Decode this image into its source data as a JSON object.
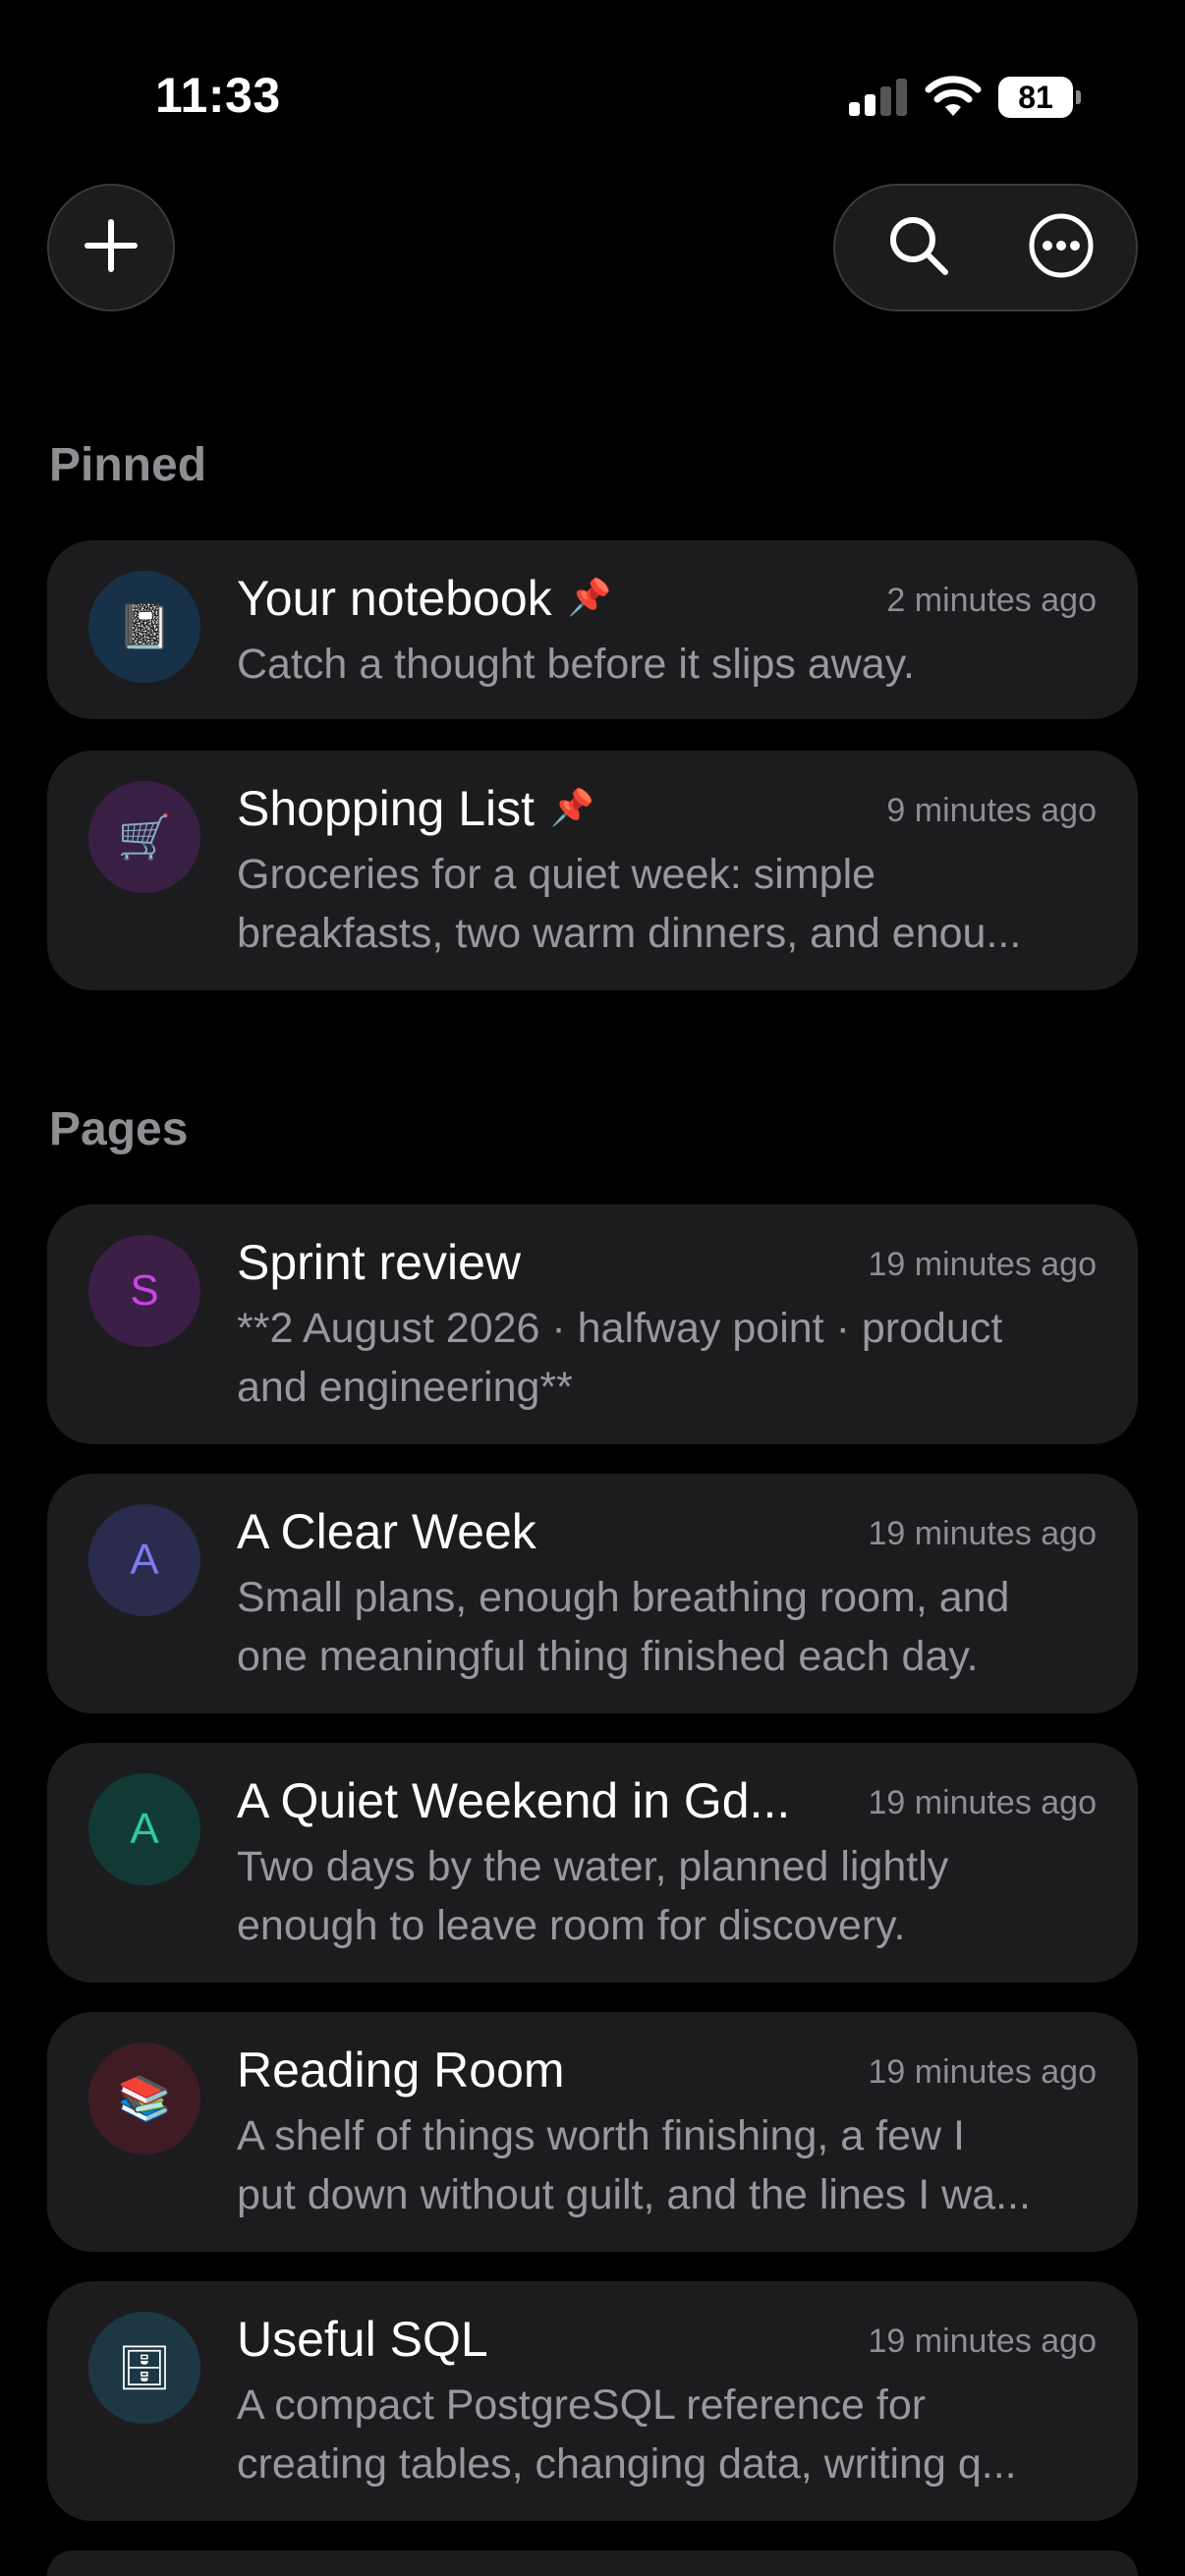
{
  "status_bar": {
    "time": "11:33",
    "battery": "81"
  },
  "sections": {
    "pinned": "Pinned",
    "pages": "Pages"
  },
  "pinned": [
    {
      "title": "Your notebook",
      "time": "2 minutes ago",
      "desc": "Catch a thought before it slips away.",
      "icon": "notebook-emoji",
      "glyph": "📓",
      "avatar_bg": "#173248"
    },
    {
      "title": "Shopping List",
      "time": "9 minutes ago",
      "desc": "Groceries for a quiet week: simple\nbreakfasts, two warm dinners, and enou...",
      "icon": "shopping-cart-emoji",
      "glyph": "🛒",
      "avatar_bg": "#3a1f45"
    }
  ],
  "pages": [
    {
      "title": "Sprint review",
      "time": "19 minutes ago",
      "desc": "**2 August 2026 · halfway point · product\nand engineering**",
      "letter": "S",
      "letter_color": "#c946e0",
      "avatar_bg": "#3b1f47"
    },
    {
      "title": "A Clear Week",
      "time": "19 minutes ago",
      "desc": "Small plans, enough breathing room, and\none meaningful thing finished each day.",
      "letter": "A",
      "letter_color": "#7b7cf2",
      "avatar_bg": "#2a2b4d"
    },
    {
      "title": "A Quiet Weekend in Gd...",
      "time": "19 minutes ago",
      "desc": "Two days by the water, planned lightly\nenough to leave room for discovery.",
      "letter": "A",
      "letter_color": "#2ec9a4",
      "avatar_bg": "#123a34"
    },
    {
      "title": "Reading Room",
      "time": "19 minutes ago",
      "desc": "A shelf of things worth finishing, a few I\nput down without guilt, and the lines I wa...",
      "icon": "books-emoji",
      "glyph": "📚",
      "avatar_bg": "#3f1c24"
    },
    {
      "title": "Useful SQL",
      "time": "19 minutes ago",
      "desc": "A compact PostgreSQL reference for\ncreating tables, changing data, writing q...",
      "icon": "file-cabinet-emoji",
      "glyph": "🗄",
      "avatar_bg": "#1d3844"
    }
  ]
}
